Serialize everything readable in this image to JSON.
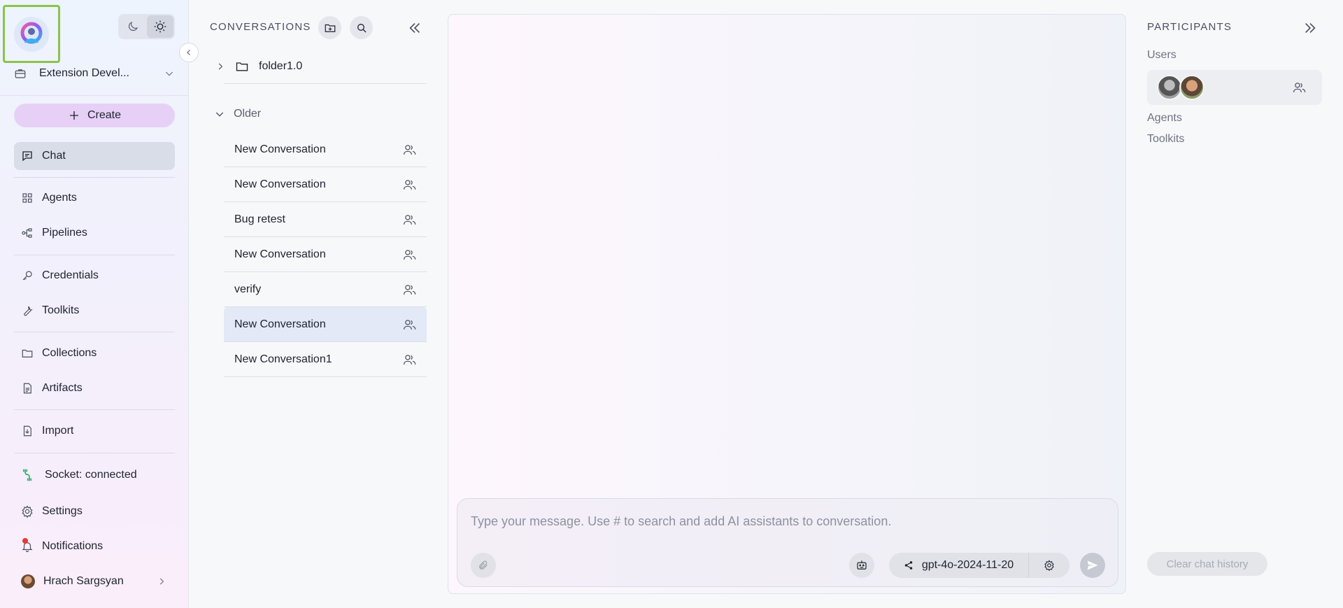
{
  "sidebar": {
    "workspace": {
      "name": "Extension Devel..."
    },
    "create_label": "Create",
    "nav": {
      "chat": "Chat",
      "agents": "Agents",
      "pipelines": "Pipelines",
      "credentials": "Credentials",
      "toolkits": "Toolkits",
      "collections": "Collections",
      "artifacts": "Artifacts",
      "import": "Import",
      "socket": "Socket: connected",
      "settings": "Settings",
      "notifications": "Notifications",
      "user": "Hrach Sargsyan"
    }
  },
  "conversations": {
    "title": "CONVERSATIONS",
    "folder": "folder1.0",
    "group_label": "Older",
    "items": [
      {
        "label": "New Conversation"
      },
      {
        "label": "New Conversation"
      },
      {
        "label": "Bug retest"
      },
      {
        "label": "New Conversation"
      },
      {
        "label": "verify"
      },
      {
        "label": "New Conversation"
      },
      {
        "label": "New Conversation1"
      }
    ],
    "selected_index": 5
  },
  "composer": {
    "placeholder": "Type your message. Use # to search and add AI assistants to conversation.",
    "model": "gpt-4o-2024-11-20"
  },
  "participants": {
    "title": "PARTICIPANTS",
    "users_label": "Users",
    "agents_label": "Agents",
    "toolkits_label": "Toolkits",
    "clear_label": "Clear chat history"
  },
  "colors": {
    "accent_create": "#e7d0f6",
    "socket_green": "#2eaa6a",
    "highlight_border": "#8bc34a",
    "notification_dot": "#e53935"
  }
}
